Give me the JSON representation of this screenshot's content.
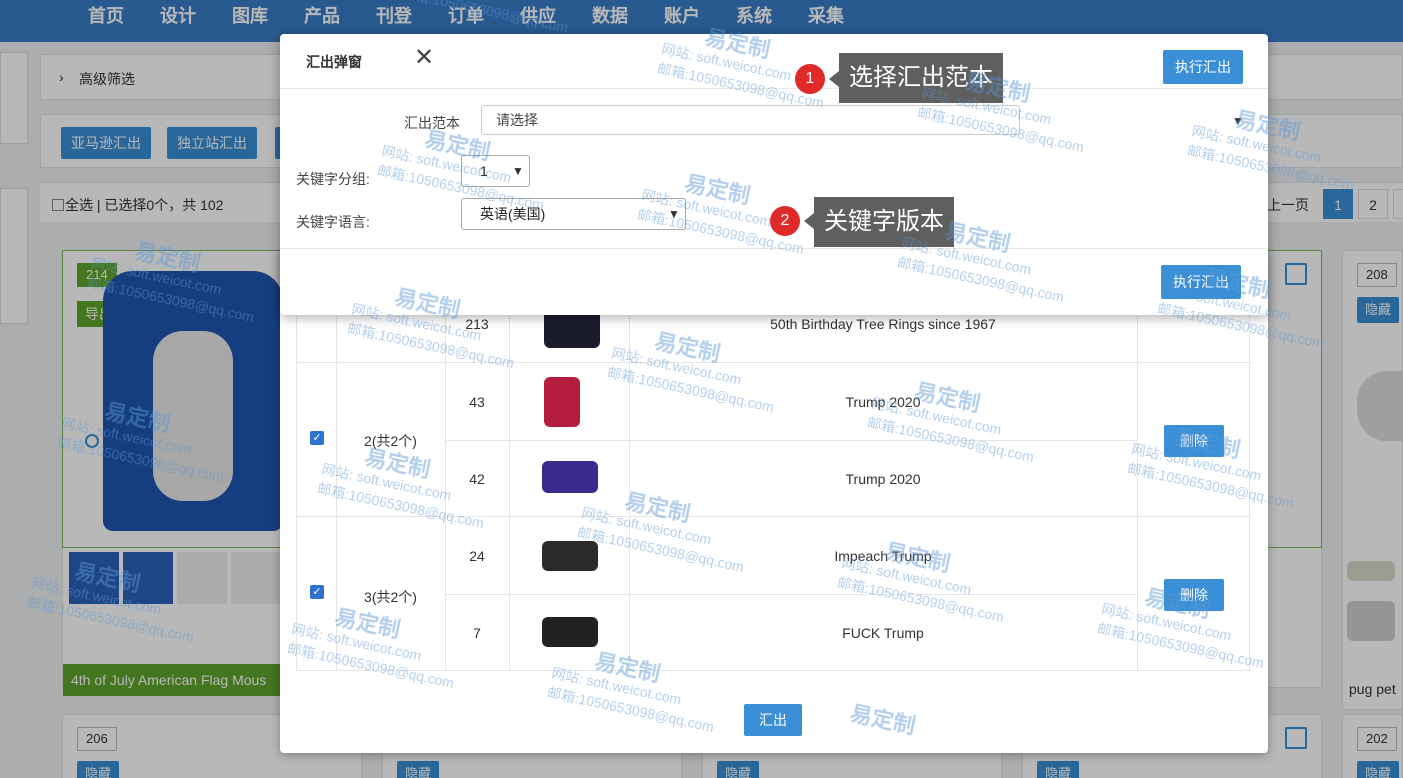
{
  "nav": [
    "首页",
    "设计",
    "图库",
    "产品",
    "刊登",
    "订单",
    "供应",
    "数据",
    "账户",
    "系统",
    "采集"
  ],
  "filter": {
    "toggle_icon": "chevron-right-icon",
    "label": "高级筛选"
  },
  "export_buttons": [
    "亚马逊汇出",
    "独立站汇出"
  ],
  "selection": {
    "text": "全选 | 已选择0个，共 102"
  },
  "pager": {
    "prev": "上一页",
    "pages": [
      "1",
      "2"
    ],
    "current": "1"
  },
  "cards": {
    "main": {
      "id": "214",
      "owner": "导出用户:admins",
      "title": "4th of July American Flag Mous"
    },
    "right_top": {
      "id": "208",
      "hide": "隐藏",
      "title": "pug pet"
    },
    "bottom": [
      {
        "id": "206",
        "hide": "隐藏"
      },
      {
        "hide": "隐藏"
      },
      {
        "hide": "隐藏"
      },
      {
        "hide": "隐藏"
      },
      {
        "id": "202",
        "hide": "隐藏"
      }
    ]
  },
  "export_dialog": {
    "title": "汇出弹窗",
    "close_icon": "close-icon",
    "run_label": "执行汇出",
    "template_label": "汇出范本",
    "template_placeholder": "请选择",
    "group_label": "关键字分组:",
    "group_value": "1",
    "lang_label": "关键字语言:",
    "lang_value": "英语(美国)"
  },
  "callouts": [
    {
      "num": "1",
      "text": "选择汇出范本"
    },
    {
      "num": "2",
      "text": "关键字版本"
    }
  ],
  "list_dialog": {
    "rows": [
      {
        "id": "213",
        "name": "50th Birthday Tree Rings since 1967"
      },
      {
        "id": "43",
        "name": "Trump 2020"
      },
      {
        "id": "42",
        "name": "Trump 2020"
      },
      {
        "id": "24",
        "name": "Impeach Trump"
      },
      {
        "id": "7",
        "name": "FUCK Trump"
      }
    ],
    "groups": [
      {
        "label": "2(共2个)",
        "delete": "删除"
      },
      {
        "label": "3(共2个)",
        "delete": "删除"
      }
    ],
    "submit": "汇出"
  },
  "watermark": {
    "brand": "易定制",
    "site": "网站: soft.weicot.com",
    "mail": "邮箱:1050653098@qq.com"
  },
  "colors": {
    "nav": "#3a7dc7",
    "button": "#3a8fd6",
    "green": "#5ea42b",
    "callout_badge": "#e02a2a",
    "callout_box": "#5f5f5f"
  }
}
